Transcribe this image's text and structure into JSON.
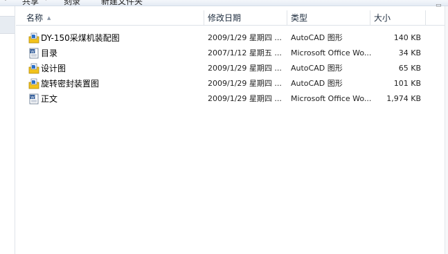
{
  "toolbar": {
    "share_label": "共享",
    "burn_label": "刻录",
    "new_folder_label": "新建文件夹"
  },
  "columns": {
    "name": "名称",
    "date": "修改日期",
    "type": "类型",
    "size": "大小",
    "sort_indicator": "▲"
  },
  "files": [
    {
      "name": "DY-150采煤机装配图",
      "date": "2009/1/29 星期四 ...",
      "type": "AutoCAD 图形",
      "size": "140 KB",
      "icon": "autocad-icon"
    },
    {
      "name": "目录",
      "date": "2007/1/12 星期五 ...",
      "type": "Microsoft Office Wo...",
      "size": "34 KB",
      "icon": "word-doc-icon"
    },
    {
      "name": "设计图",
      "date": "2009/1/29 星期四 ...",
      "type": "AutoCAD 图形",
      "size": "65 KB",
      "icon": "autocad-icon"
    },
    {
      "name": "旋转密封装置图",
      "date": "2009/1/29 星期四 ...",
      "type": "AutoCAD 图形",
      "size": "101 KB",
      "icon": "autocad-icon"
    },
    {
      "name": "正文",
      "date": "2009/1/29 星期四 ...",
      "type": "Microsoft Office Wo...",
      "size": "1,974 KB",
      "icon": "word-doc-icon"
    }
  ],
  "colors": {
    "autocad_blue": "#2a6fc9",
    "autocad_yellow": "#f2c21b",
    "word_blue": "#2b5797"
  }
}
